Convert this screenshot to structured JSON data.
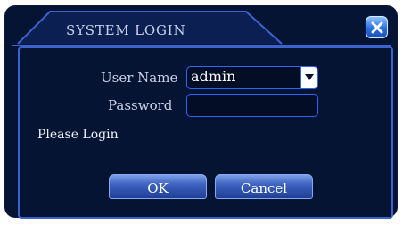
{
  "dialog": {
    "title": "SYSTEM LOGIN",
    "close_icon": "close-icon",
    "username_label": "User Name",
    "username_value": "admin",
    "password_label": "Password",
    "password_value": "",
    "status_text": "Please Login",
    "ok_label": "OK",
    "cancel_label": "Cancel"
  },
  "colors": {
    "background": "#061433",
    "border_blue": "#3b63cf",
    "field_border": "#2d66ff",
    "text": "#c9d2e8"
  }
}
